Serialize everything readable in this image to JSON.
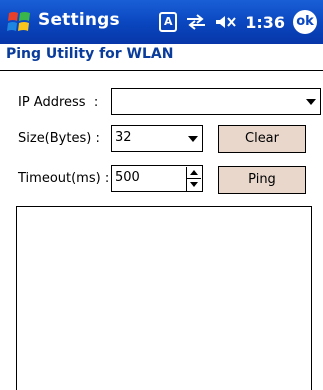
{
  "titlebar": {
    "app_title": "Settings",
    "input_indicator": "A",
    "time": "1:36",
    "ok_label": "ok",
    "colors": {
      "bar": "#0a47c0",
      "text": "#ffffff"
    }
  },
  "subtitle": "Ping Utility for WLAN",
  "form": {
    "ip_label": "IP Address  :",
    "ip_value": "",
    "size_label": "Size(Bytes) :",
    "size_value": "32",
    "timeout_label": "Timeout(ms) :",
    "timeout_value": "500",
    "clear_label": "Clear",
    "ping_label": "Ping"
  },
  "output": {
    "text": ""
  },
  "icons": [
    "windows-start-icon",
    "input-mode-icon",
    "connectivity-icon",
    "speaker-icon",
    "dropdown-arrow-icon",
    "spinner-up-icon",
    "spinner-down-icon"
  ]
}
